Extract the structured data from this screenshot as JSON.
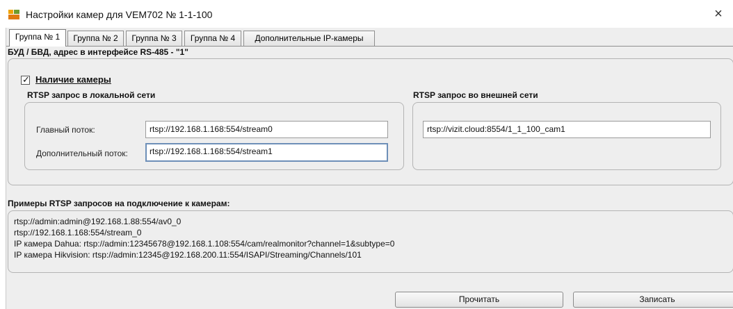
{
  "window": {
    "title": "Настройки камер для VEM702 № 1-1-100",
    "close_glyph": "×",
    "icon": "app-logo-icon"
  },
  "tabs": [
    {
      "label": "Группа № 1",
      "active": true
    },
    {
      "label": "Группа № 2",
      "active": false
    },
    {
      "label": "Группа № 3",
      "active": false
    },
    {
      "label": "Группа № 4",
      "active": false
    },
    {
      "label": "Дополнительные IP-камеры",
      "active": false
    }
  ],
  "device": {
    "header": "БУД / БВД, адрес в интерфейсе RS-485 - \"1\""
  },
  "camera": {
    "checkbox_label": "Наличие камеры",
    "checked": true,
    "check_glyph": "✓"
  },
  "local": {
    "header": "RTSP запрос в локальной сети",
    "main_label": "Главный поток:",
    "main_value": "rtsp://192.168.1.168:554/stream0",
    "extra_label": "Дополнительный поток:",
    "extra_value": "rtsp://192.168.1.168:554/stream1"
  },
  "external": {
    "header": "RTSP запрос во внешней сети",
    "value": "rtsp://vizit.cloud:8554/1_1_100_cam1"
  },
  "examples": {
    "header": "Примеры RTSP запросов на подключение к камерам:",
    "lines": [
      "rtsp://admin:admin@192.168.1.88:554/av0_0",
      "rtsp://192.168.1.168:554/stream_0",
      "IP камера Dahua: rtsp://admin:12345678@192.168.1.108:554/cam/realmonitor?channel=1&subtype=0",
      "IP камера Hikvision: rtsp://admin:12345@192.168.200.11:554/ISAPI/Streaming/Channels/101"
    ]
  },
  "buttons": {
    "read_label": "Прочитать",
    "write_label": "Записать"
  }
}
